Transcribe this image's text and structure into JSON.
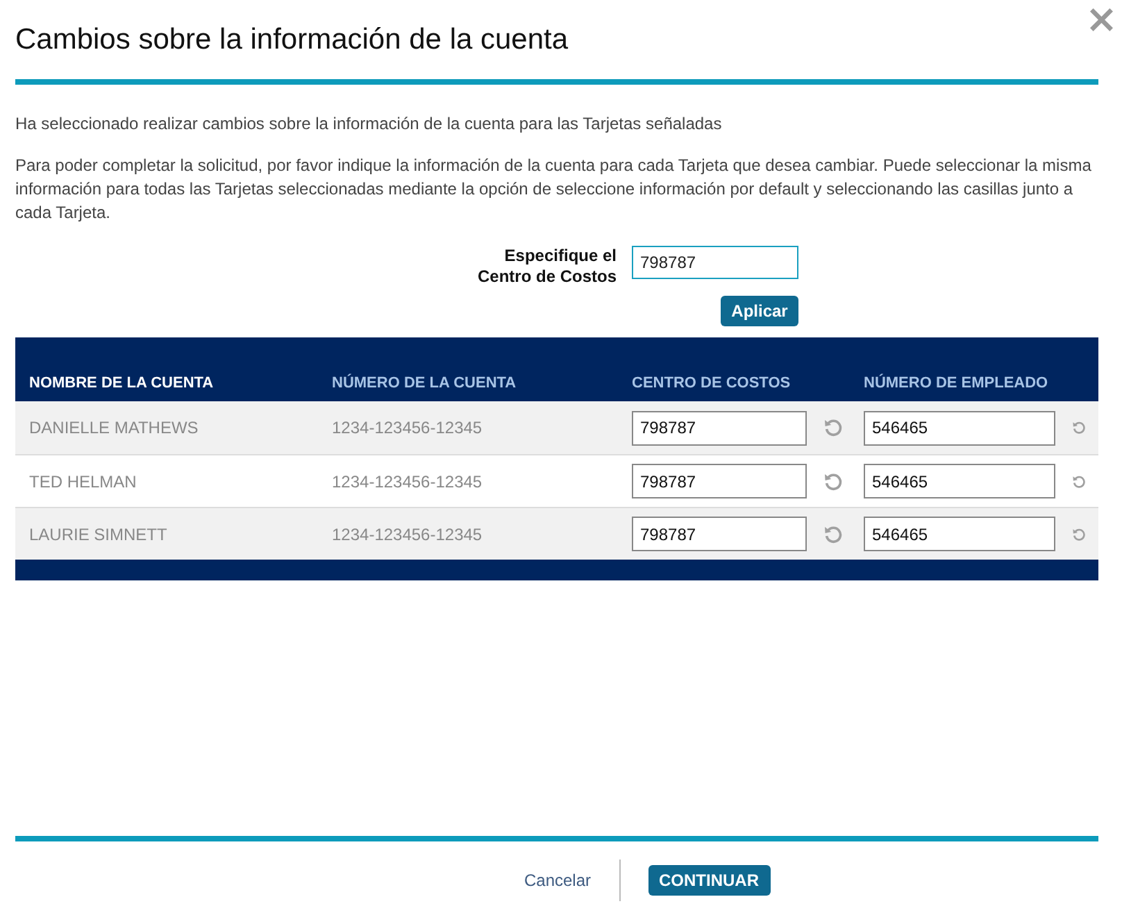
{
  "dialog": {
    "title": "Cambios sobre la información de la cuenta",
    "close": "×"
  },
  "intro": [
    "Ha seleccionado realizar cambios sobre la información de la cuenta para las Tarjetas señaladas",
    "Para poder completar la solicitud, por favor indique la información de la cuenta para cada Tarjeta que desea cambiar. Puede seleccionar la misma información para todas las Tarjetas seleccionadas mediante la opción de seleccione información por default y seleccionando las casillas junto a cada Tarjeta."
  ],
  "default_form": {
    "label": "Especifique el Centro de Costos",
    "value": "798787",
    "button": "Aplicar"
  },
  "table": {
    "columns": [
      {
        "label": "NOMBRE DE LA CUENTA",
        "active": true
      },
      {
        "label": "NÚMERO DE LA CUENTA",
        "active": false
      },
      {
        "label": "CENTRO DE COSTOS",
        "active": false
      },
      {
        "label": "NÚMERO DE EMPLEADO",
        "active": false
      }
    ],
    "rows": [
      {
        "name": "DANIELLE MATHEWS",
        "account": "1234-123456-12345",
        "cost_center": "798787",
        "employee": "546465"
      },
      {
        "name": "TED HELMAN",
        "account": "1234-123456-12345",
        "cost_center": "798787",
        "employee": "546465"
      },
      {
        "name": "LAURIE SIMNETT",
        "account": "1234-123456-12345",
        "cost_center": "798787",
        "employee": "546465"
      }
    ]
  },
  "footer": {
    "cancel": "Cancelar",
    "continue": "CONTINUAR"
  }
}
